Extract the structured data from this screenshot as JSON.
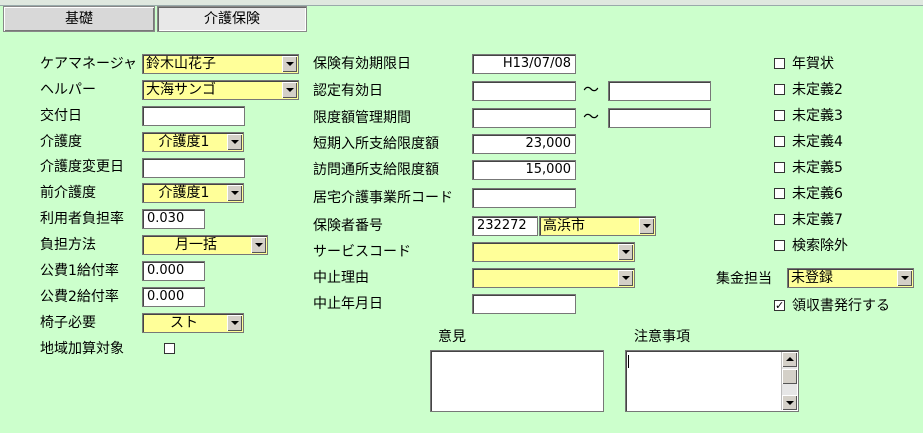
{
  "tabs": [
    {
      "label": "基礎"
    },
    {
      "label": "介護保険"
    }
  ],
  "left": {
    "care_manager": {
      "label": "ケアマネージャ",
      "value": "鈴木山花子"
    },
    "helper": {
      "label": "ヘルパー",
      "value": "大海サンゴ"
    },
    "issue_date": {
      "label": "交付日",
      "value": ""
    },
    "care_level": {
      "label": "介護度",
      "value": "介護度1"
    },
    "care_level_change_date": {
      "label": "介護度変更日",
      "value": ""
    },
    "prev_care_level": {
      "label": "前介護度",
      "value": "介護度1"
    },
    "user_burden_rate": {
      "label": "利用者負担率",
      "value": "0.030"
    },
    "burden_method": {
      "label": "負担方法",
      "value": "月一括"
    },
    "public1_rate": {
      "label": "公費1給付率",
      "value": "0.000"
    },
    "public2_rate": {
      "label": "公費2給付率",
      "value": "0.000"
    },
    "chair_needed": {
      "label": "椅子必要",
      "value": "スト"
    },
    "regional_addition": {
      "label": "地域加算対象"
    }
  },
  "middle": {
    "insurance_expiry": {
      "label": "保険有効期限日",
      "value": "H13/07/08"
    },
    "cert_valid": {
      "label": "認定有効日",
      "from": "",
      "to": ""
    },
    "limit_period": {
      "label": "限度額管理期間",
      "from": "",
      "to": ""
    },
    "tilde": "～",
    "short_stay_limit": {
      "label": "短期入所支給限度額",
      "value": "23,000"
    },
    "visit_limit": {
      "label": "訪問通所支給限度額",
      "value": "15,000"
    },
    "home_care_office_code": {
      "label": "居宅介護事業所コード",
      "value": ""
    },
    "insurer_no": {
      "label": "保険者番号",
      "value": "232272",
      "city": "高浜市"
    },
    "service_code": {
      "label": "サービスコード",
      "value": ""
    },
    "stop_reason": {
      "label": "中止理由",
      "value": ""
    },
    "stop_date": {
      "label": "中止年月日",
      "value": ""
    }
  },
  "opinion": {
    "label": "意見"
  },
  "notes": {
    "label": "注意事項"
  },
  "right": {
    "checks": [
      {
        "label": "年賀状",
        "checked": false
      },
      {
        "label": "未定義2",
        "checked": false
      },
      {
        "label": "未定義3",
        "checked": false
      },
      {
        "label": "未定義4",
        "checked": false
      },
      {
        "label": "未定義5",
        "checked": false
      },
      {
        "label": "未定義6",
        "checked": false
      },
      {
        "label": "未定義7",
        "checked": false
      },
      {
        "label": "検索除外",
        "checked": false
      }
    ],
    "collector": {
      "label": "集金担当",
      "value": "未登録"
    },
    "issue_receipt": {
      "label": "領収書発行する",
      "checked": true,
      "mark": "✓"
    }
  },
  "colors": {
    "background": "#ccffcc",
    "combo": "#ffff99"
  }
}
